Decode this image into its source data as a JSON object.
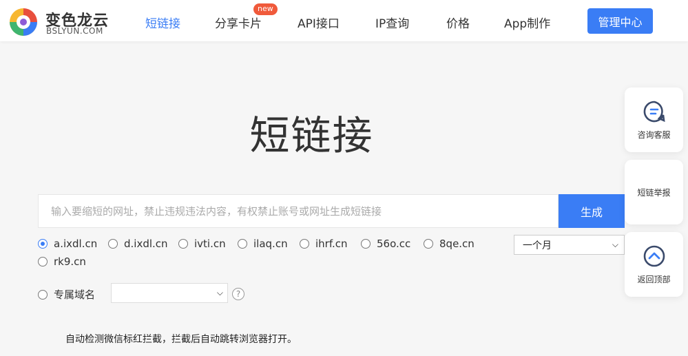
{
  "brand": {
    "name_cn": "变色龙云",
    "name_en": "BSLYUN.COM"
  },
  "nav": {
    "items": [
      {
        "label": "短链接",
        "active": true
      },
      {
        "label": "分享卡片",
        "active": false
      },
      {
        "label": "API接口",
        "active": false
      },
      {
        "label": "IP查询",
        "active": false
      },
      {
        "label": "价格",
        "active": false
      },
      {
        "label": "App制作",
        "active": false
      }
    ],
    "new_badge": "new",
    "admin_label": "管理中心"
  },
  "main": {
    "title": "短链接",
    "input_placeholder": "输入要缩短的网址，禁止违规违法内容，有权禁止账号或网址生成短链接",
    "input_value": "",
    "generate_label": "生成",
    "domains": [
      {
        "label": "a.ixdl.cn",
        "checked": true
      },
      {
        "label": "d.ixdl.cn",
        "checked": false
      },
      {
        "label": "ivti.cn",
        "checked": false
      },
      {
        "label": "ilaq.cn",
        "checked": false
      },
      {
        "label": "ihrf.cn",
        "checked": false
      },
      {
        "label": "56o.cc",
        "checked": false
      },
      {
        "label": "8qe.cn",
        "checked": false
      },
      {
        "label": "rk9.cn",
        "checked": false
      }
    ],
    "period_selected": "一个月",
    "custom_domain_label": "专属域名",
    "custom_domain_value": "",
    "help_glyph": "?",
    "note": "自动检测微信标红拦截，拦截后自动跳转浏览器打开。"
  },
  "side": {
    "consult_label": "咨询客服",
    "report_label": "短链举报",
    "top_label": "返回顶部"
  },
  "colors": {
    "accent": "#3a7df5",
    "badge": "#f05a3b",
    "background": "#f6f6f6"
  }
}
